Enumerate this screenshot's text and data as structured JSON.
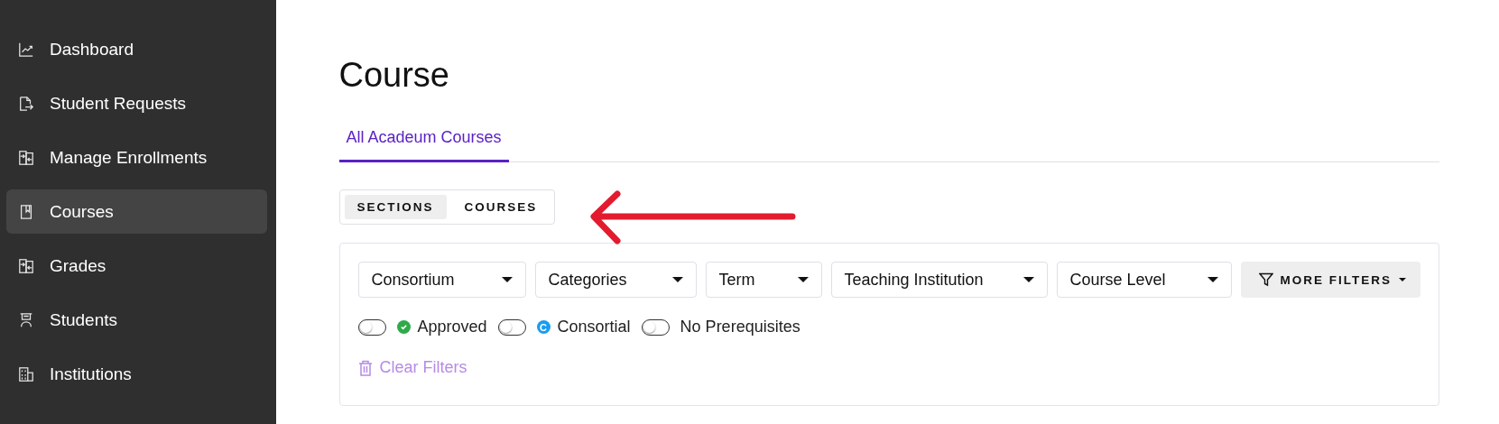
{
  "sidebar": {
    "items": [
      {
        "label": "Dashboard",
        "selected": false
      },
      {
        "label": "Student Requests",
        "selected": false
      },
      {
        "label": "Manage Enrollments",
        "selected": false
      },
      {
        "label": "Courses",
        "selected": true
      },
      {
        "label": "Grades",
        "selected": false
      },
      {
        "label": "Students",
        "selected": false
      },
      {
        "label": "Institutions",
        "selected": false
      }
    ]
  },
  "page": {
    "title": "Course",
    "tabs": [
      {
        "label": "All Acadeum Courses",
        "selected": true
      }
    ]
  },
  "view_switch": [
    {
      "label": "SECTIONS",
      "selected": true
    },
    {
      "label": "COURSES",
      "selected": false
    }
  ],
  "filters": {
    "dropdowns": [
      "Consortium",
      "Categories",
      "Term",
      "Teaching Institution",
      "Course Level"
    ],
    "more_filters": "MORE FILTERS",
    "toggles": [
      {
        "kind": "check",
        "label": "Approved",
        "on": false,
        "color": "#2eaa4a"
      },
      {
        "kind": "letter",
        "label": "Consortial",
        "on": false,
        "badge_text": "C",
        "color": "#1a9cf0"
      },
      {
        "kind": "plain",
        "label": "No Prerequisites",
        "on": false
      }
    ],
    "clear": "Clear Filters"
  }
}
